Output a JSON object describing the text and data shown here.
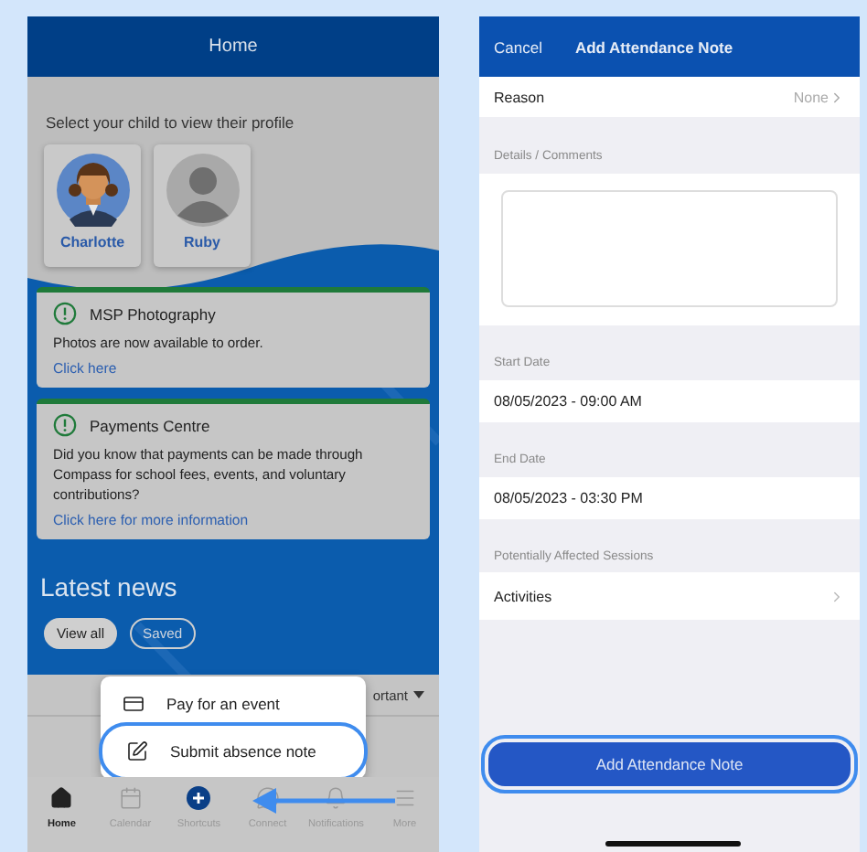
{
  "home_screen": {
    "header": {
      "title": "Home"
    },
    "prompt": "Select your child to view their profile",
    "students": [
      {
        "name": "Charlotte",
        "kind": "photo",
        "selected": false
      },
      {
        "name": "Ruby",
        "kind": "placeholder",
        "selected": false
      }
    ],
    "notices": [
      {
        "title": "MSP Photography",
        "body": "Photos are now available to order.",
        "link": "Click here"
      },
      {
        "title": "Payments Centre",
        "body": "Did you know that payments can be made through Compass for school fees, events, and voluntary contributions?",
        "link": "Click here for more information"
      }
    ],
    "news": {
      "title": "Latest news",
      "filters": [
        {
          "label": "View all",
          "selected": true
        },
        {
          "label": "Saved",
          "selected": false
        }
      ],
      "sort": "ortant"
    },
    "shortcut_menu": [
      {
        "label": "Pay for an event",
        "kind": "card",
        "highlighted": false
      },
      {
        "label": "Submit absence note",
        "kind": "edit",
        "highlighted": true
      }
    ],
    "tab_bar": [
      {
        "label": "Home",
        "kind": "home",
        "selected": true
      },
      {
        "label": "Calendar",
        "kind": "calendar",
        "selected": false
      },
      {
        "label": "Shortcuts",
        "kind": "plus",
        "selected": false
      },
      {
        "label": "Connect",
        "kind": "chat",
        "selected": false
      },
      {
        "label": "Notifications",
        "kind": "bell",
        "selected": false
      },
      {
        "label": "More",
        "kind": "menu",
        "selected": false
      }
    ]
  },
  "note_screen": {
    "header": {
      "cancel": "Cancel",
      "title": "Add Attendance Note"
    },
    "reason": {
      "label": "Reason",
      "value": "None"
    },
    "sections": [
      {
        "heading": "Details / Comments",
        "kind": "textarea"
      },
      {
        "heading": "Start Date",
        "kind": "value",
        "value": "08/05/2023 - 09:00 AM"
      },
      {
        "heading": "End Date",
        "kind": "value",
        "value": "08/05/2023 - 03:30 PM"
      },
      {
        "heading": "Potentially Affected Sessions",
        "kind": "link",
        "value": "Activities"
      }
    ],
    "submit": {
      "label": "Add Attendance Note",
      "highlighted": true
    }
  }
}
